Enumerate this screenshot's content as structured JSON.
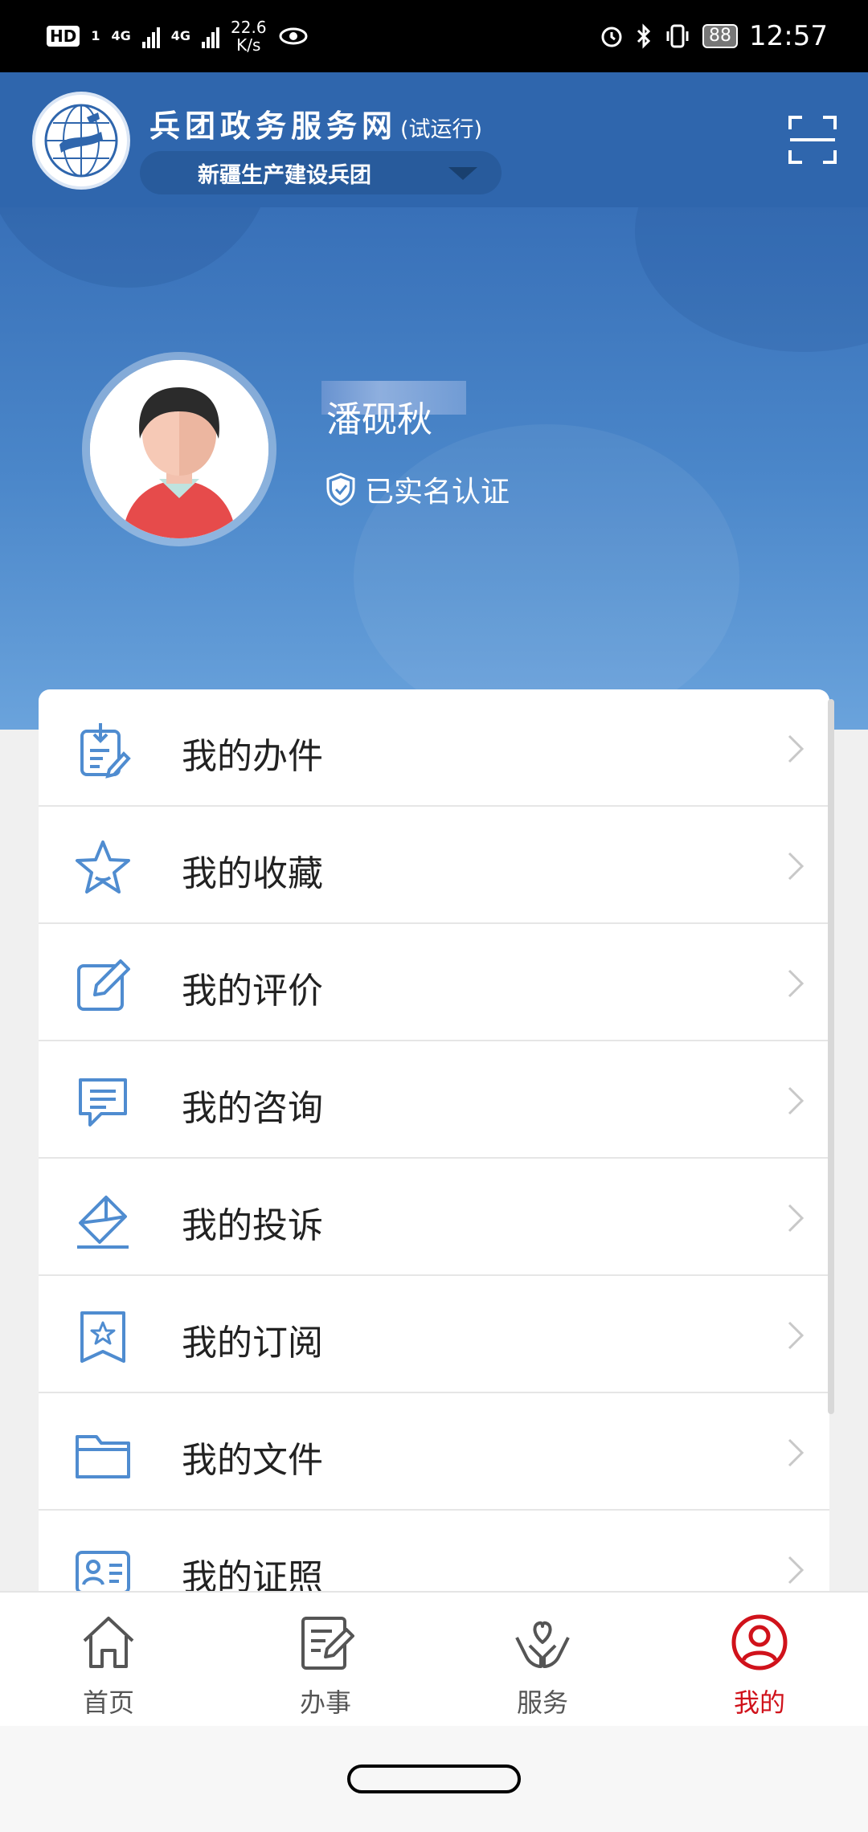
{
  "status_bar": {
    "hd": "HD",
    "sim": "1",
    "network_1": "4G",
    "network_2": "4G",
    "speed_value": "22.6",
    "speed_unit": "K/s",
    "battery": "88",
    "time": "12:57"
  },
  "header": {
    "title": "兵团政务服务网",
    "title_note": "(试运行)",
    "region": "新疆生产建设兵团",
    "scan_icon": "scan-icon"
  },
  "profile": {
    "name": "潘砚秋",
    "verified_label": "已实名认证"
  },
  "menu": [
    {
      "label": "我的办件",
      "icon": "task-download-icon"
    },
    {
      "label": "我的收藏",
      "icon": "star-icon"
    },
    {
      "label": "我的评价",
      "icon": "edit-icon"
    },
    {
      "label": "我的咨询",
      "icon": "message-icon"
    },
    {
      "label": "我的投诉",
      "icon": "complaint-envelope-icon"
    },
    {
      "label": "我的订阅",
      "icon": "bookmark-star-icon"
    },
    {
      "label": "我的文件",
      "icon": "folder-icon"
    },
    {
      "label": "我的证照",
      "icon": "id-card-icon"
    }
  ],
  "tabs": [
    {
      "label": "首页",
      "icon": "home-icon",
      "active": false
    },
    {
      "label": "办事",
      "icon": "document-edit-icon",
      "active": false
    },
    {
      "label": "服务",
      "icon": "heart-hands-icon",
      "active": false
    },
    {
      "label": "我的",
      "icon": "user-icon",
      "active": true
    }
  ],
  "colors": {
    "header_blue": "#2f66ad",
    "icon_blue": "#4f8cd0",
    "active_red": "#d0121b",
    "text_dark": "#222222"
  }
}
